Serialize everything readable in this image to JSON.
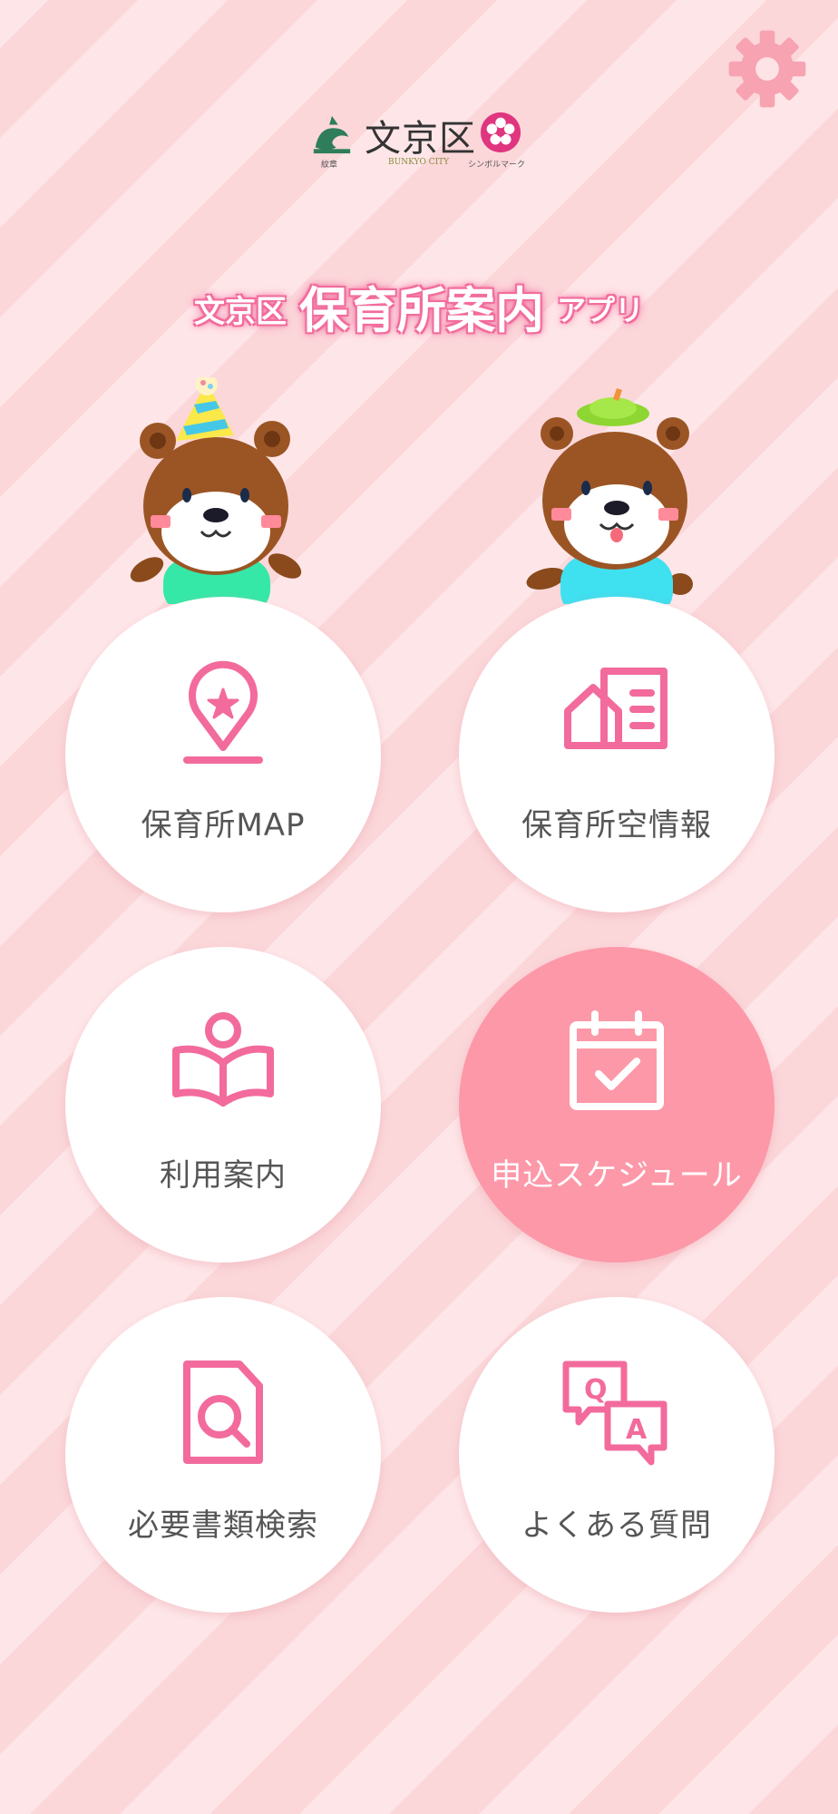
{
  "header": {
    "settings_icon": "gear-icon",
    "logo": {
      "name": "文京区",
      "emblem_caption": "紋章",
      "city_caption": "BUNKYO CITY",
      "symbol_caption": "シンボルマーク"
    },
    "title": {
      "prefix": "文京区",
      "main": "保育所案内",
      "suffix": "アプリ"
    }
  },
  "menu": {
    "items": [
      {
        "label": "保育所MAP",
        "icon": "map-pin-star-icon"
      },
      {
        "label": "保育所空情報",
        "icon": "house-document-icon"
      },
      {
        "label": "利用案内",
        "icon": "person-reading-icon"
      },
      {
        "label": "申込スケジュール",
        "icon": "calendar-check-icon",
        "selected": true
      },
      {
        "label": "必要書類検索",
        "icon": "document-search-icon"
      },
      {
        "label": "よくある質問",
        "icon": "qa-bubbles-icon"
      }
    ]
  },
  "colors": {
    "accent": "#f26b9c",
    "active_button": "#fd98a8",
    "background": "#fde3e5",
    "gear": "#f7a3b2"
  }
}
